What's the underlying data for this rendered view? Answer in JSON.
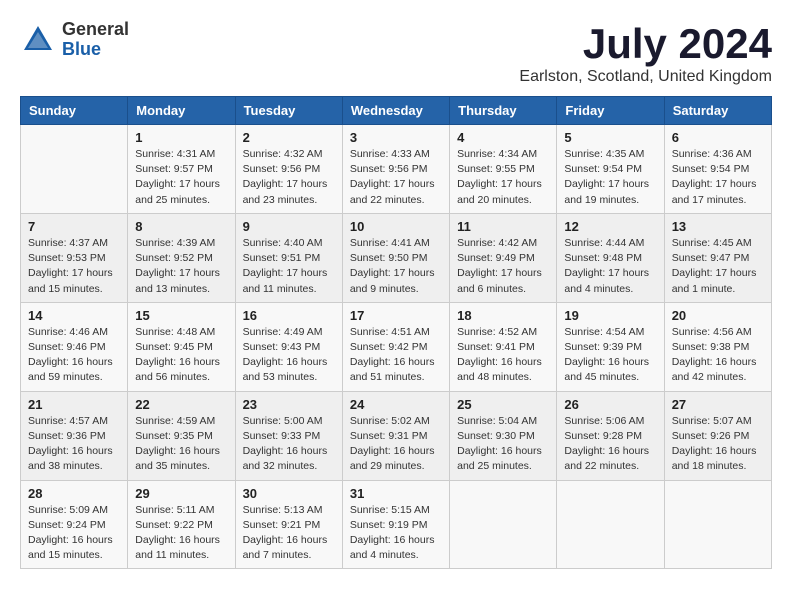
{
  "logo": {
    "general": "General",
    "blue": "Blue"
  },
  "title": "July 2024",
  "subtitle": "Earlston, Scotland, United Kingdom",
  "days_header": [
    "Sunday",
    "Monday",
    "Tuesday",
    "Wednesday",
    "Thursday",
    "Friday",
    "Saturday"
  ],
  "weeks": [
    [
      {
        "day": "",
        "sunrise": "",
        "sunset": "",
        "daylight": ""
      },
      {
        "day": "1",
        "sunrise": "Sunrise: 4:31 AM",
        "sunset": "Sunset: 9:57 PM",
        "daylight": "Daylight: 17 hours and 25 minutes."
      },
      {
        "day": "2",
        "sunrise": "Sunrise: 4:32 AM",
        "sunset": "Sunset: 9:56 PM",
        "daylight": "Daylight: 17 hours and 23 minutes."
      },
      {
        "day": "3",
        "sunrise": "Sunrise: 4:33 AM",
        "sunset": "Sunset: 9:56 PM",
        "daylight": "Daylight: 17 hours and 22 minutes."
      },
      {
        "day": "4",
        "sunrise": "Sunrise: 4:34 AM",
        "sunset": "Sunset: 9:55 PM",
        "daylight": "Daylight: 17 hours and 20 minutes."
      },
      {
        "day": "5",
        "sunrise": "Sunrise: 4:35 AM",
        "sunset": "Sunset: 9:54 PM",
        "daylight": "Daylight: 17 hours and 19 minutes."
      },
      {
        "day": "6",
        "sunrise": "Sunrise: 4:36 AM",
        "sunset": "Sunset: 9:54 PM",
        "daylight": "Daylight: 17 hours and 17 minutes."
      }
    ],
    [
      {
        "day": "7",
        "sunrise": "Sunrise: 4:37 AM",
        "sunset": "Sunset: 9:53 PM",
        "daylight": "Daylight: 17 hours and 15 minutes."
      },
      {
        "day": "8",
        "sunrise": "Sunrise: 4:39 AM",
        "sunset": "Sunset: 9:52 PM",
        "daylight": "Daylight: 17 hours and 13 minutes."
      },
      {
        "day": "9",
        "sunrise": "Sunrise: 4:40 AM",
        "sunset": "Sunset: 9:51 PM",
        "daylight": "Daylight: 17 hours and 11 minutes."
      },
      {
        "day": "10",
        "sunrise": "Sunrise: 4:41 AM",
        "sunset": "Sunset: 9:50 PM",
        "daylight": "Daylight: 17 hours and 9 minutes."
      },
      {
        "day": "11",
        "sunrise": "Sunrise: 4:42 AM",
        "sunset": "Sunset: 9:49 PM",
        "daylight": "Daylight: 17 hours and 6 minutes."
      },
      {
        "day": "12",
        "sunrise": "Sunrise: 4:44 AM",
        "sunset": "Sunset: 9:48 PM",
        "daylight": "Daylight: 17 hours and 4 minutes."
      },
      {
        "day": "13",
        "sunrise": "Sunrise: 4:45 AM",
        "sunset": "Sunset: 9:47 PM",
        "daylight": "Daylight: 17 hours and 1 minute."
      }
    ],
    [
      {
        "day": "14",
        "sunrise": "Sunrise: 4:46 AM",
        "sunset": "Sunset: 9:46 PM",
        "daylight": "Daylight: 16 hours and 59 minutes."
      },
      {
        "day": "15",
        "sunrise": "Sunrise: 4:48 AM",
        "sunset": "Sunset: 9:45 PM",
        "daylight": "Daylight: 16 hours and 56 minutes."
      },
      {
        "day": "16",
        "sunrise": "Sunrise: 4:49 AM",
        "sunset": "Sunset: 9:43 PM",
        "daylight": "Daylight: 16 hours and 53 minutes."
      },
      {
        "day": "17",
        "sunrise": "Sunrise: 4:51 AM",
        "sunset": "Sunset: 9:42 PM",
        "daylight": "Daylight: 16 hours and 51 minutes."
      },
      {
        "day": "18",
        "sunrise": "Sunrise: 4:52 AM",
        "sunset": "Sunset: 9:41 PM",
        "daylight": "Daylight: 16 hours and 48 minutes."
      },
      {
        "day": "19",
        "sunrise": "Sunrise: 4:54 AM",
        "sunset": "Sunset: 9:39 PM",
        "daylight": "Daylight: 16 hours and 45 minutes."
      },
      {
        "day": "20",
        "sunrise": "Sunrise: 4:56 AM",
        "sunset": "Sunset: 9:38 PM",
        "daylight": "Daylight: 16 hours and 42 minutes."
      }
    ],
    [
      {
        "day": "21",
        "sunrise": "Sunrise: 4:57 AM",
        "sunset": "Sunset: 9:36 PM",
        "daylight": "Daylight: 16 hours and 38 minutes."
      },
      {
        "day": "22",
        "sunrise": "Sunrise: 4:59 AM",
        "sunset": "Sunset: 9:35 PM",
        "daylight": "Daylight: 16 hours and 35 minutes."
      },
      {
        "day": "23",
        "sunrise": "Sunrise: 5:00 AM",
        "sunset": "Sunset: 9:33 PM",
        "daylight": "Daylight: 16 hours and 32 minutes."
      },
      {
        "day": "24",
        "sunrise": "Sunrise: 5:02 AM",
        "sunset": "Sunset: 9:31 PM",
        "daylight": "Daylight: 16 hours and 29 minutes."
      },
      {
        "day": "25",
        "sunrise": "Sunrise: 5:04 AM",
        "sunset": "Sunset: 9:30 PM",
        "daylight": "Daylight: 16 hours and 25 minutes."
      },
      {
        "day": "26",
        "sunrise": "Sunrise: 5:06 AM",
        "sunset": "Sunset: 9:28 PM",
        "daylight": "Daylight: 16 hours and 22 minutes."
      },
      {
        "day": "27",
        "sunrise": "Sunrise: 5:07 AM",
        "sunset": "Sunset: 9:26 PM",
        "daylight": "Daylight: 16 hours and 18 minutes."
      }
    ],
    [
      {
        "day": "28",
        "sunrise": "Sunrise: 5:09 AM",
        "sunset": "Sunset: 9:24 PM",
        "daylight": "Daylight: 16 hours and 15 minutes."
      },
      {
        "day": "29",
        "sunrise": "Sunrise: 5:11 AM",
        "sunset": "Sunset: 9:22 PM",
        "daylight": "Daylight: 16 hours and 11 minutes."
      },
      {
        "day": "30",
        "sunrise": "Sunrise: 5:13 AM",
        "sunset": "Sunset: 9:21 PM",
        "daylight": "Daylight: 16 hours and 7 minutes."
      },
      {
        "day": "31",
        "sunrise": "Sunrise: 5:15 AM",
        "sunset": "Sunset: 9:19 PM",
        "daylight": "Daylight: 16 hours and 4 minutes."
      },
      {
        "day": "",
        "sunrise": "",
        "sunset": "",
        "daylight": ""
      },
      {
        "day": "",
        "sunrise": "",
        "sunset": "",
        "daylight": ""
      },
      {
        "day": "",
        "sunrise": "",
        "sunset": "",
        "daylight": ""
      }
    ]
  ]
}
